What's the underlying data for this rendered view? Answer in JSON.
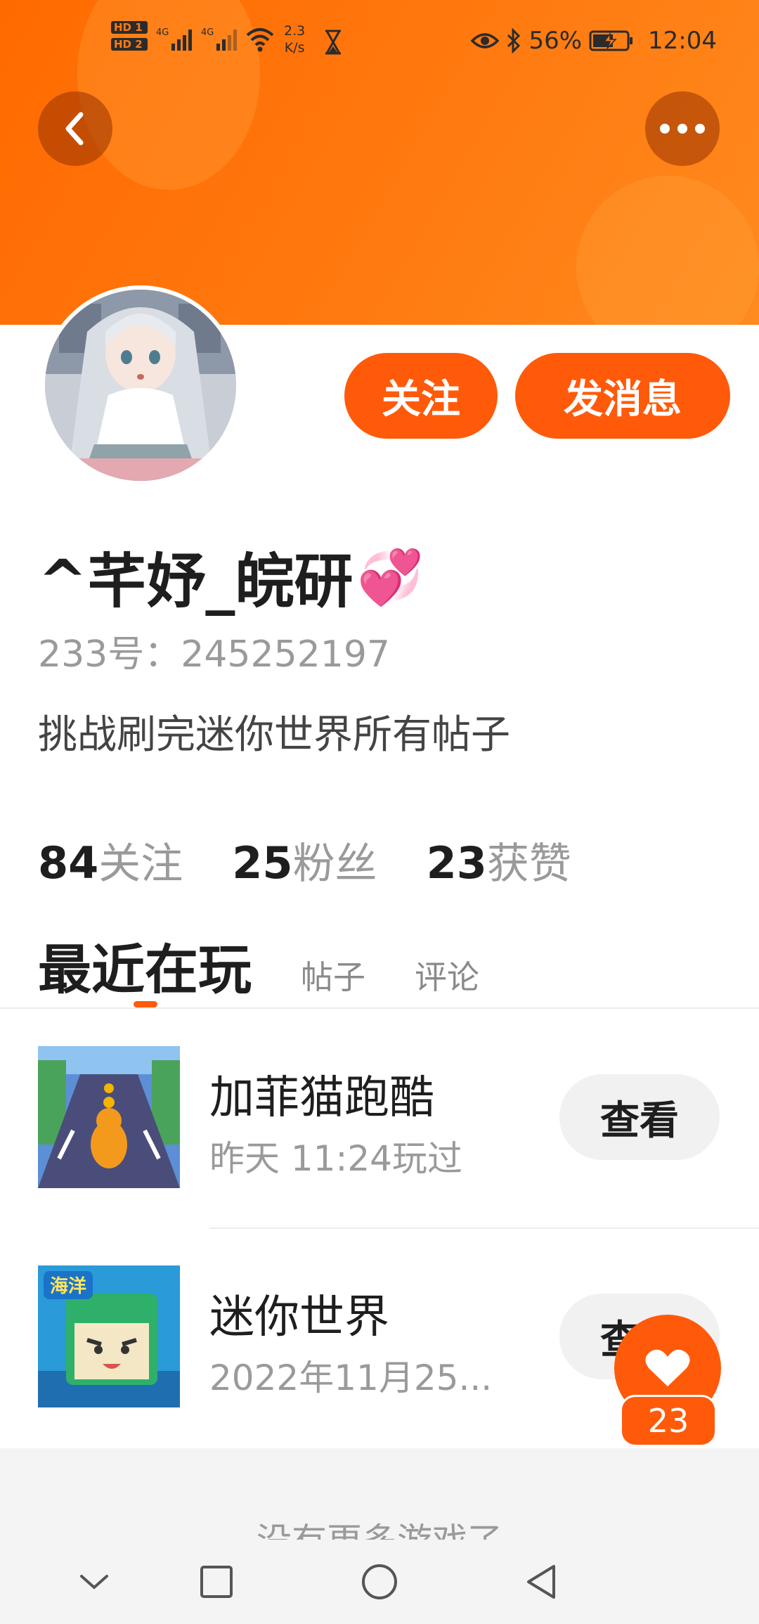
{
  "status_bar": {
    "hd1": "HD 1",
    "hd2": "HD 2",
    "net1": "4G",
    "net2": "4G",
    "speed_value": "2.3",
    "speed_unit": "K/s",
    "battery": "56%",
    "time": "12:04"
  },
  "profile": {
    "username": "^芊妤_皖研",
    "emoji": "💞",
    "uid": "233号：245252197",
    "bio": "挑战刷完迷你世界所有帖子",
    "follow_label": "关注",
    "message_label": "发消息"
  },
  "stats": [
    {
      "num": "84",
      "label": "关注"
    },
    {
      "num": "25",
      "label": "粉丝"
    },
    {
      "num": "23",
      "label": "获赞"
    }
  ],
  "tabs": {
    "active": "最近在玩",
    "posts": "帖子",
    "comments": "评论"
  },
  "games": [
    {
      "title": "加菲猫跑酷",
      "subtitle": "昨天 11:24玩过",
      "button": "查看"
    },
    {
      "title": "迷你世界",
      "subtitle": "2022年11月25...",
      "button": "查看",
      "thumb_badge": "海洋"
    }
  ],
  "footer": {
    "no_more": "没有更多游戏了"
  },
  "like": {
    "count": "23"
  },
  "colors": {
    "accent": "#ff5a0a",
    "header": "#ff7a10"
  }
}
